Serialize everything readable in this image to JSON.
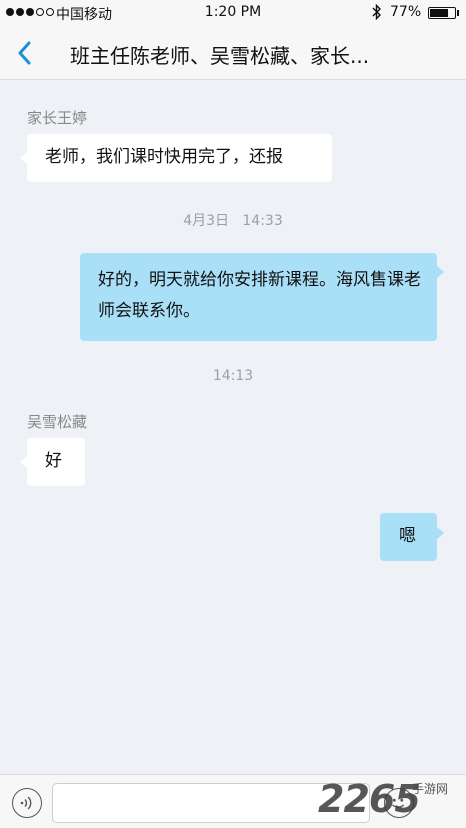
{
  "status_bar": {
    "carrier": "中国移动",
    "time": "1:20 PM",
    "battery_percent": "77%",
    "battery_level": 0.77,
    "signal_bars_filled": 3,
    "signal_bars_total": 5,
    "bluetooth_icon": "bluetooth-icon"
  },
  "nav": {
    "title": "班主任陈老师、吴雪松藏、家长...",
    "back_icon": "chevron-left-icon",
    "accent_color": "#1a8fd6"
  },
  "messages": [
    {
      "sender": "家长王婷",
      "text": "老师，我们课时快用完了，还报",
      "direction": "incoming"
    },
    {
      "timestamp": "4月3日   14:33"
    },
    {
      "text": "好的，明天就给你安排新课程。海风售课老师会联系你。",
      "direction": "outgoing"
    },
    {
      "timestamp": "14:13"
    },
    {
      "sender": "吴雪松藏",
      "text": "好",
      "direction": "incoming"
    },
    {
      "text": "嗯",
      "direction": "outgoing"
    }
  ],
  "input_bar": {
    "voice_icon": "voice-icon",
    "emoji_icon": "emoji-icon",
    "placeholder": ""
  },
  "watermark": {
    "text": "2265",
    "sub": "手游网"
  },
  "colors": {
    "outgoing_bubble": "#a9dff7",
    "incoming_bubble": "#ffffff",
    "chat_background": "#eef1f5"
  }
}
